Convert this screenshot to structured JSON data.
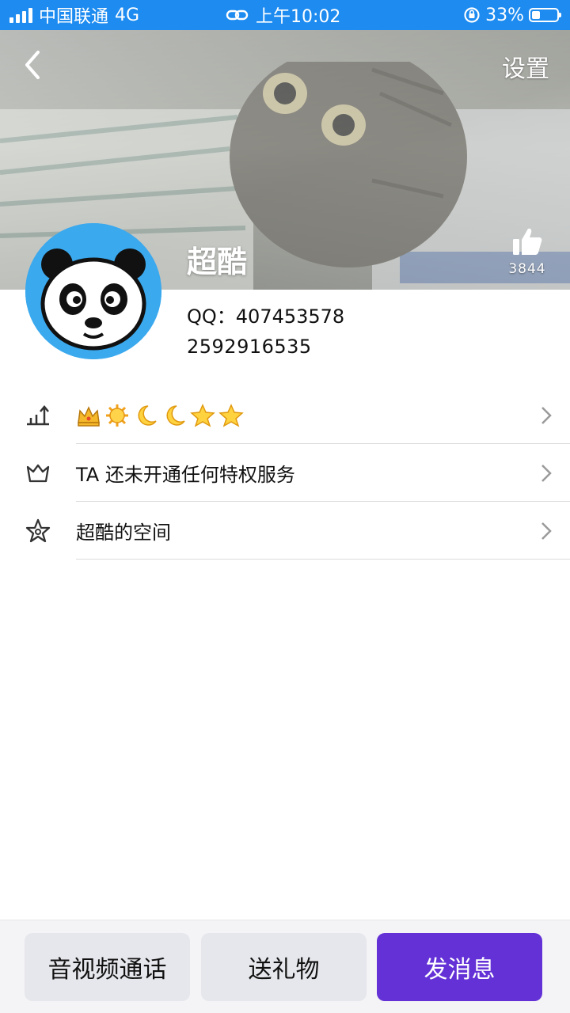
{
  "status_bar": {
    "carrier": "中国联通",
    "network": "4G",
    "time": "上午10:02",
    "battery_percent": "33%",
    "battery_level": 0.33,
    "color": "#1d8bf0"
  },
  "header": {
    "back_icon": "chevron-left-icon",
    "settings_label": "设置"
  },
  "profile": {
    "nickname": "超酷",
    "qq_line": "QQ：407453578",
    "second_line": "2592916535",
    "like_count": "3844",
    "avatar_icon": "panda-avatar-icon"
  },
  "menu": {
    "items": [
      {
        "icon": "level-chart-icon",
        "label": "",
        "badges": [
          "crown-icon",
          "sun-icon",
          "moon-icon",
          "moon-icon",
          "star-icon",
          "star-icon"
        ]
      },
      {
        "icon": "crown-outline-icon",
        "label": "TA 还未开通任何特权服务"
      },
      {
        "icon": "star-outline-icon",
        "label": "超酷的空间"
      }
    ]
  },
  "bottom_bar": {
    "call_label": "音视频通话",
    "gift_label": "送礼物",
    "message_label": "发消息",
    "primary_color": "#6331d6"
  }
}
